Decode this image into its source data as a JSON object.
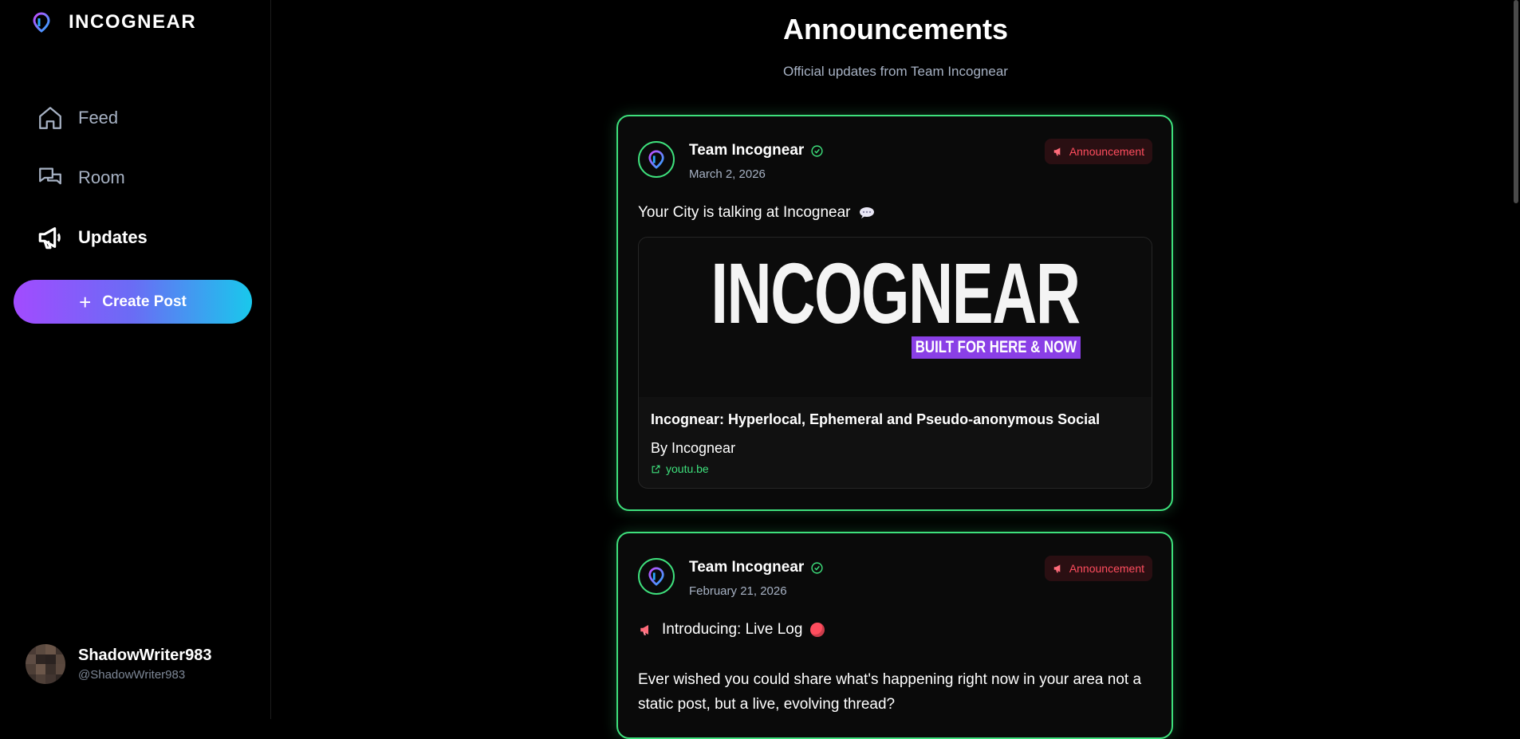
{
  "brand": {
    "name": "INCOGNEAR"
  },
  "nav": {
    "items": [
      {
        "label": "Feed",
        "icon": "home-icon",
        "active": false
      },
      {
        "label": "Room",
        "icon": "chat-bubbles-icon",
        "active": false
      },
      {
        "label": "Updates",
        "icon": "megaphone-icon",
        "active": true
      }
    ]
  },
  "create_post": {
    "label": "Create Post"
  },
  "user": {
    "name": "ShadowWriter983",
    "handle": "@ShadowWriter983"
  },
  "page": {
    "title": "Announcements",
    "subtitle": "Official updates from Team Incognear"
  },
  "posts": [
    {
      "author": "Team Incognear",
      "date": "March 2, 2026",
      "badge": "Announcement",
      "text": "Your City is talking at Incognear",
      "link": {
        "image_brand": "INCOGNEAR",
        "image_tagline": "BUILT FOR HERE & NOW",
        "title": "Incognear: Hyperlocal, Ephemeral and Pseudo-anonymous Social",
        "by": "By Incognear",
        "domain": "youtu.be"
      }
    },
    {
      "author": "Team Incognear",
      "date": "February 21, 2026",
      "badge": "Announcement",
      "text": "Introducing: Live Log",
      "body": "Ever wished you could share what's happening right now in your area not a static post, but a live, evolving thread?"
    }
  ],
  "colors": {
    "accent_green": "#3ee07c",
    "badge_red": "#ff4d5e",
    "muted": "#a7b2c4"
  }
}
